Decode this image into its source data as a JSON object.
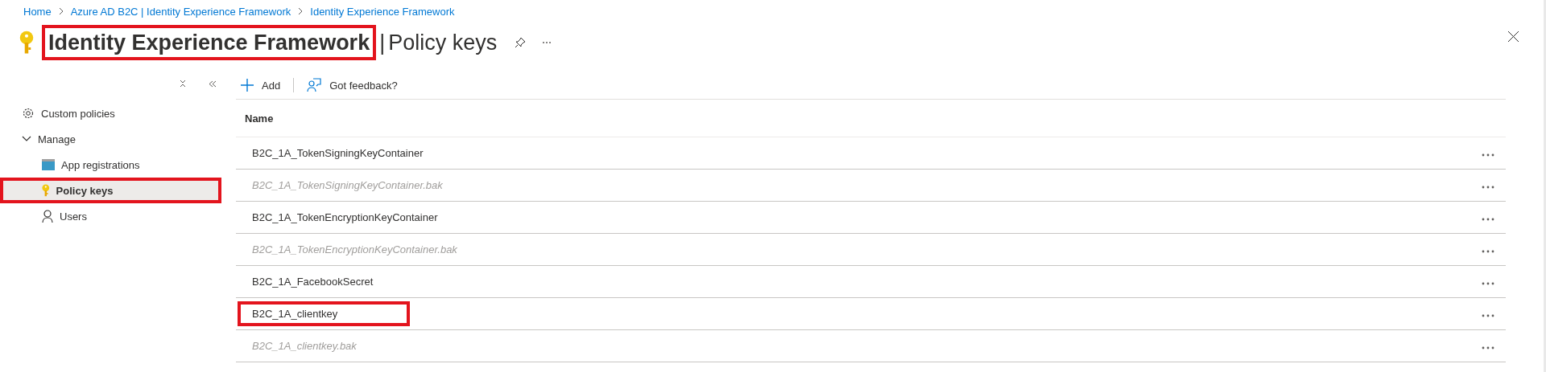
{
  "breadcrumb": [
    {
      "label": "Home"
    },
    {
      "label": "Azure AD B2C | Identity Experience Framework"
    },
    {
      "label": "Identity Experience Framework"
    }
  ],
  "header": {
    "title": "Identity Experience Framework",
    "separator": "|",
    "subtitle": "Policy keys",
    "title_highlighted": true
  },
  "sidebar": {
    "items": [
      {
        "label": "Custom policies",
        "kind": "gear",
        "selected": false,
        "highlighted": false
      },
      {
        "label": "Manage",
        "kind": "group",
        "expanded": true,
        "children": [
          {
            "label": "App registrations",
            "kind": "app",
            "selected": false,
            "highlighted": false
          },
          {
            "label": "Policy keys",
            "kind": "key",
            "selected": true,
            "highlighted": true
          },
          {
            "label": "Users",
            "kind": "user",
            "selected": false,
            "highlighted": false
          }
        ]
      }
    ]
  },
  "toolbar": [
    {
      "label": "Add",
      "kind": "add"
    },
    {
      "label": "Got feedback?",
      "kind": "feedback"
    }
  ],
  "table": {
    "columns": [
      "Name"
    ],
    "rows": [
      {
        "name": "B2C_1A_TokenSigningKeyContainer",
        "disabled": false,
        "highlighted": false
      },
      {
        "name": "B2C_1A_TokenSigningKeyContainer.bak",
        "disabled": true,
        "highlighted": false
      },
      {
        "name": "B2C_1A_TokenEncryptionKeyContainer",
        "disabled": false,
        "highlighted": false
      },
      {
        "name": "B2C_1A_TokenEncryptionKeyContainer.bak",
        "disabled": true,
        "highlighted": false
      },
      {
        "name": "B2C_1A_FacebookSecret",
        "disabled": false,
        "highlighted": false
      },
      {
        "name": "B2C_1A_clientkey",
        "disabled": false,
        "highlighted": true
      },
      {
        "name": "B2C_1A_clientkey.bak",
        "disabled": true,
        "highlighted": false
      }
    ]
  }
}
